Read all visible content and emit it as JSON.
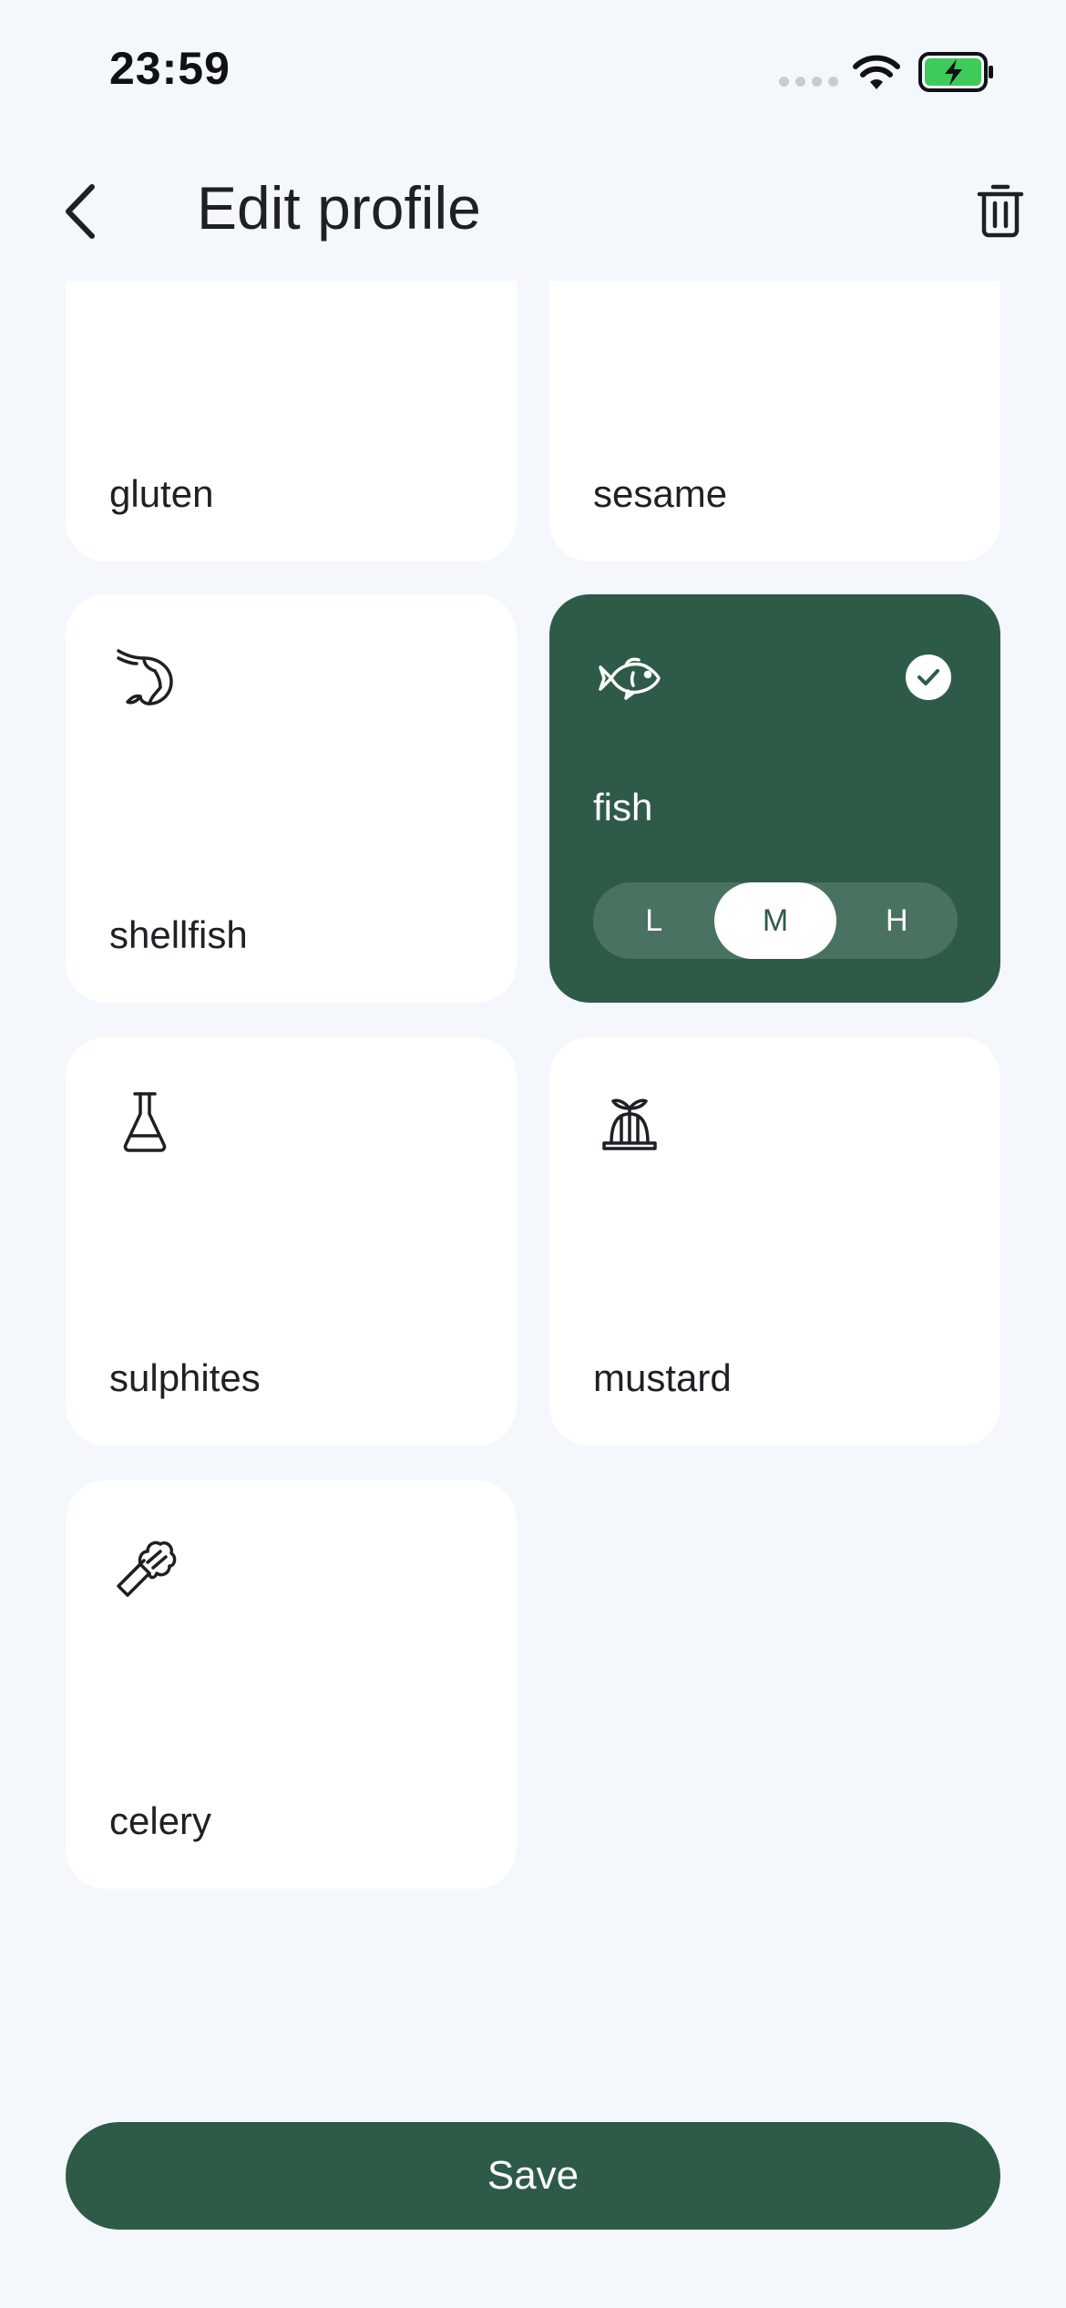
{
  "status_bar": {
    "time": "23:59"
  },
  "header": {
    "title": "Edit profile",
    "back_icon": "chevron-left-icon",
    "delete_icon": "trash-icon"
  },
  "allergens": [
    {
      "label": "gluten",
      "icon": "wheat-icon",
      "selected": false
    },
    {
      "label": "sesame",
      "icon": "seeds-icon",
      "selected": false
    },
    {
      "label": "shellfish",
      "icon": "shrimp-icon",
      "selected": false
    },
    {
      "label": "fish",
      "icon": "fish-icon",
      "selected": true,
      "levels": [
        "L",
        "M",
        "H"
      ],
      "active_level": "M"
    },
    {
      "label": "sulphites",
      "icon": "flask-icon",
      "selected": false
    },
    {
      "label": "mustard",
      "icon": "mustard-jelly-icon",
      "selected": false
    },
    {
      "label": "celery",
      "icon": "celery-icon",
      "selected": false
    }
  ],
  "save_label": "Save",
  "colors": {
    "background": "#f4f7fc",
    "accent": "#2e5b48",
    "card": "#ffffff"
  }
}
